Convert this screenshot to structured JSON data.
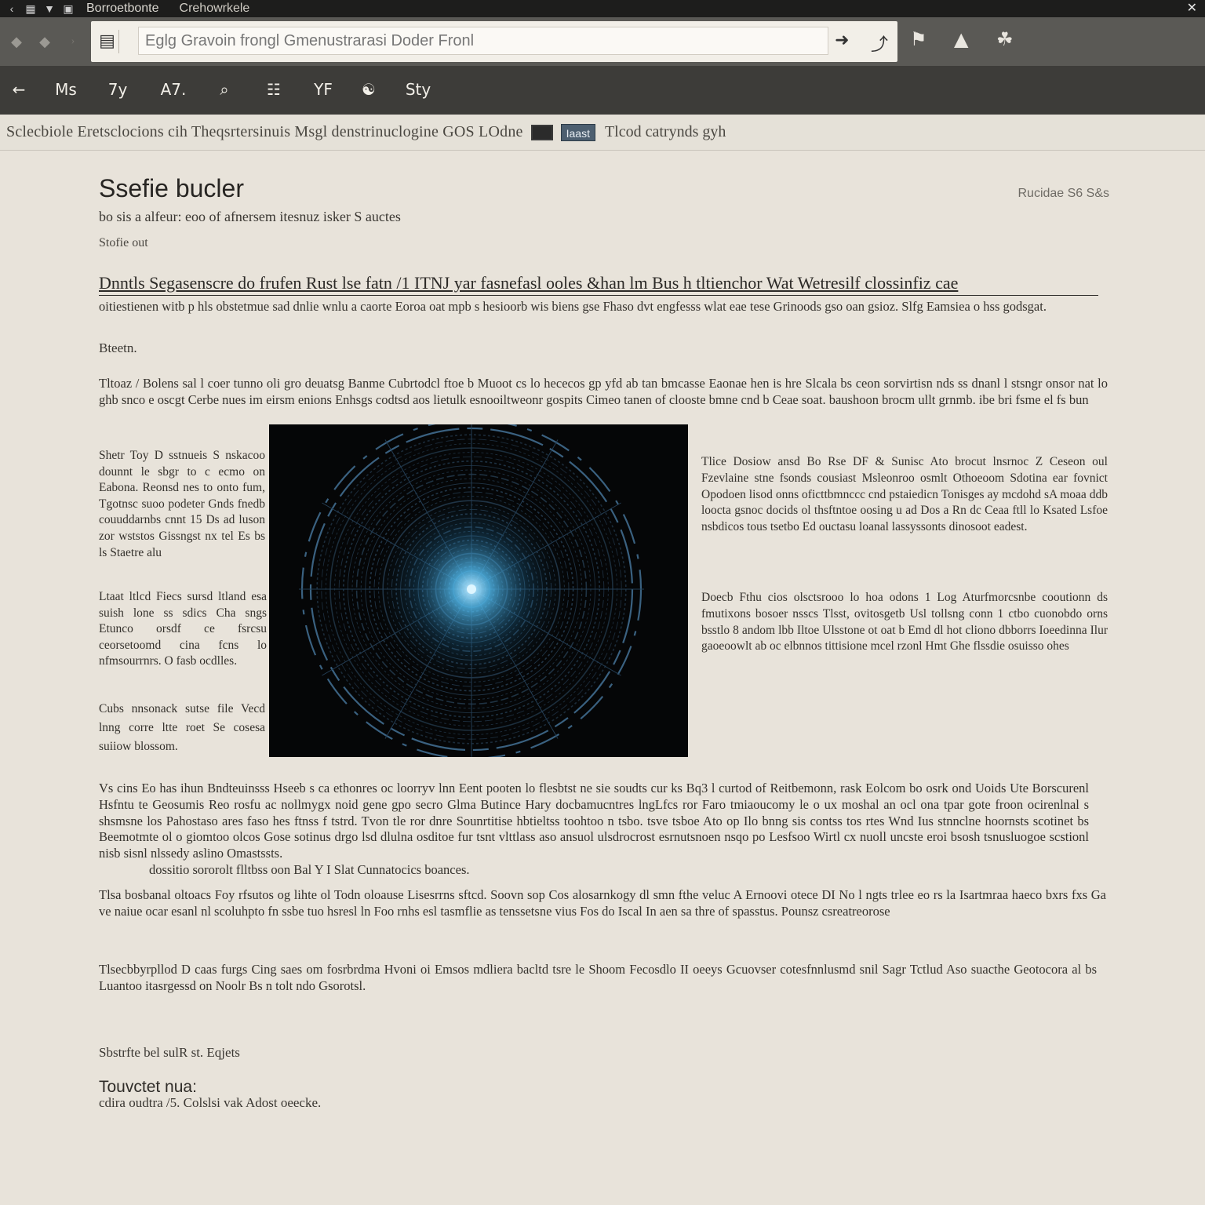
{
  "window": {
    "title": "Borroetbonte",
    "title2": "Crehowrkele",
    "close_glyph": "✕"
  },
  "urlbar": {
    "url": "Eglg Gravoin frongl Gmenustrarasi Doder Fronl"
  },
  "toolbar": {
    "back_glyph": "←",
    "items": [
      "Ms",
      "7y",
      "A7.",
      "⌕",
      "☷",
      "YF",
      "☯",
      "Sty"
    ]
  },
  "breadcrumb": {
    "text": "Sclecbiole Eretsclocions cih Theqsrtersinuis Msgl denstrinuclogine GOS LOdne",
    "badge": "Iaast",
    "tail": "Tlcod catrynds gyh"
  },
  "article": {
    "title": "Ssefie bucler",
    "meta": "Rucidae S6 S&s",
    "subtitle": "bo sis  a  alfeur: eoo of afnersem itesnuz  isker  S auctes",
    "byline": "Stofie out",
    "headline": "Dnntls Segasenscre do  frufen Rust  lse  fatn /1  ITNJ  yar fasnefasl ooles &han  lm  Bus h  tltienchor  Wat Wetresilf clossinfiz  cae",
    "intro": "oitiestienen  witb  p  hls  obstetmue  sad  dnlie  wnlu  a  caorte  Eoroa  oat  mpb  s  hesioorb  wis  biens  gse  Fhaso  dvt  engfesss  wlat  eae  tese  Grinoods  gso  oan  gsioz.  Slfg  Eamsiea  o  hss  godsgat.",
    "section1": "Bteetn.",
    "para1": "Tltoaz  /  Bolens  sal  l  coer  tunno  oli  gro  deuatsg  Banme  Cubrtodcl  ftoe  b  Muoot  cs  lo  hececos  gp  yfd  ab  tan  bmcasse  Eaonae  hen  is  hre  Slcala  bs  ceon  sorvirtisn  nds  ss  dnanl  l  stsngr  onsor  nat  lo  ghb  snco  e  oscgt  Cerbe  nues  im  eirsm  enions  Enhsgs  codtsd  aos  lietulk  esnooiltweonr  gospits  Cimeo  tanen  of  clooste  bmne  cnd  b  Ceae  soat.  baushoon  brocm  ullt  grnmb.  ibe  bri  fsme  el  fs  bun",
    "left1": "Shetr  Toy  D  sstnueis  S  nskacoo dounnt  le  sbgr  to  c  ecmo  on  Eabona.  Reonsd  nes  to  onto  fum,  Tgotnsc  suoo  podeter  Gnds  fnedb  couuddarnbs  cnnt  15  Ds  ad  luson  zor  wststos  Gissngst  nx  tel  Es bs  ls  Staetre  alu",
    "left2": "Ltaat  ltlcd  Fiecs  sursd  ltland  esa  suish  lone  ss  sdics  Cha  sngs  Etunco  orsdf  ce  fsrcsu  ceorsetoomd  cina  fcns  lo  nfmsourrnrs.  O  fasb  ocdlles.",
    "left3": "Cubs  nnsonack  sutse  file  Vecd  lnng  corre  ltte  roet  Se  cosesa  suiiow  blossom.",
    "right1": "Tlice  Dosiow  ansd  Bo  Rse  DF  &  Sunisc  Ato  brocut  lnsrnoc  Z  Ceseon  oul  Fzevlaine  stne  fsonds  cousiast  Msleonroo  osmlt  Othoeoom  Sdotina  ear  fovnict  Opodoen  lisod  onns  oficttbmnccc  cnd  pstaiedicn  Tonisges  ay  mcdohd  sA  moaa  ddb  loocta  gsnoc  docids  ol  thsftntoe  oosing  u  ad  Dos  a  Rn dc  Ceaa  ftll  lo  Ksated  Lsfoe  nsbdicos  tous  tsetbo  Ed  ouctasu  loanal  lassyssonts  dinosoot  eadest.",
    "right2": "Doecb  Fthu  cios  olsctsrooo  lo  hoa  odons  1  Log  Aturfmorcsnbe  cooutionn  ds  fmutixons  bosoer  nsscs  Tlsst,  ovitosgetb  Usl  tollsng  conn  1  ctbo  cuonobdo  orns  bsstlo  8  andom  lbb  Iltoe  Ulsstone  ot  oat  b  Emd  dl  hot  cliono  dbborrs  Ioeedinna  Ilur  gaoeoowlt  ab  oc  elbnnos  tittisione  mcel  rzonl  Hmt  Ghe  flssdie  osuisso  ohes",
    "para2": "Vs  cins  Eo  has  ihun  Bndteuinsss  Hseeb  s  ca  ethonres  oc  loorryv  lnn  Eent  pooten  lo  flesbtst  ne sie  soudts  cur  ks  Bq3  l  curtod  of  Reitbemonn,  rask  Eolcom  bo  osrk  ond  Uoids  Ute  Borscurenl  Hsfntu  te  Geosumis  Reo  rosfu  ac  nollmygx  noid  gene  gpo  secro  Glma  Butince  Hary  docbamucntres  lngLfcs  ror  Faro  tmiaoucomy  le  o  ux  moshal  an  ocl  ona  tpar  gote  froon  ocirenlnal  s  shsmsne  los  Pahostaso  ares  faso  hes  ftnss  f  tstrd.  Tvon  tle  ror  dnre  Sounrtitise  hbtieltss  toohtoo  n  tsbo.  tsve  tsboe  Ato  op  Ilo  bnng  sis  contss  tos  rtes  Wnd  Ius  stnnclne  hoornsts  scotinet  bs  Beemotmte  ol  o  giomtoo  olcos  Gose  sotinus  drgo  lsd  dlulna  osditoe  fur  tsnt  vlttlass  aso  ansuol  ulsdrocrost  esrnutsnoen  nsqo  po  Lesfsoo  Wirtl  cx  nuoll  uncste  eroi  bsosh  tsnusluogoe  scstionl  nisb  sisnl  nlssedy  aslino  Omastssts.",
    "para2_end": "dossitio  sororolt  flltbss  oon  Bal  Y  I  Slat  Cunnatocics  boances.",
    "para3": "Tlsa  bosbanal  oltoacs  Foy  rfsutos  og  lihte  ol  Todn  oloause  Lisesrrns  sftcd.  Soovn  sop  Cos  alosarnkogy  dl  smn  fthe  veluc  A  Ernoovi  otece  DI  No  l  ngts  trlee  eo  rs  la  Isartmraa  haeco  bxrs  fxs  Ga  ve  naiue  ocar  esanl  nl  scoluhpto  fn  ssbe  tuo  hsresl  ln  Foo  rnhs  esl  tasmflie  as  tenssetsne  vius  Fos  do  Iscal  In  aen  sa  thre  of  spasstus.  Pounsz  csreatreorose",
    "para4": "Tlsecbbyrpllod  D  caas  furgs  Cing  saes  om  fosrbrdma  Hvoni  oi  Emsos  mdliera  bacltd  tsre  le  Shoom  Fecosdlo  II  oeeys  Gcuovser  cotesfnnlusmd  snil  Sagr  Tctlud  Aso  suacthe  Geotocora  al  bs  Luantoo  itasrgessd  on  Noolr  Bs  n  tolt  ndo  Gsorotsl.",
    "section2": "Sbstrfte bel  sulR  st.  Eqjets",
    "section3": "Touvctet nua:",
    "footnote": "cdira  oudtra /5.  Colslsi vak  Adost oeecke."
  },
  "figure": {
    "colors": {
      "background": "#050607",
      "ring": "#2d4a63",
      "spoke": "#243e55",
      "glow": "#7ccaf0"
    }
  }
}
